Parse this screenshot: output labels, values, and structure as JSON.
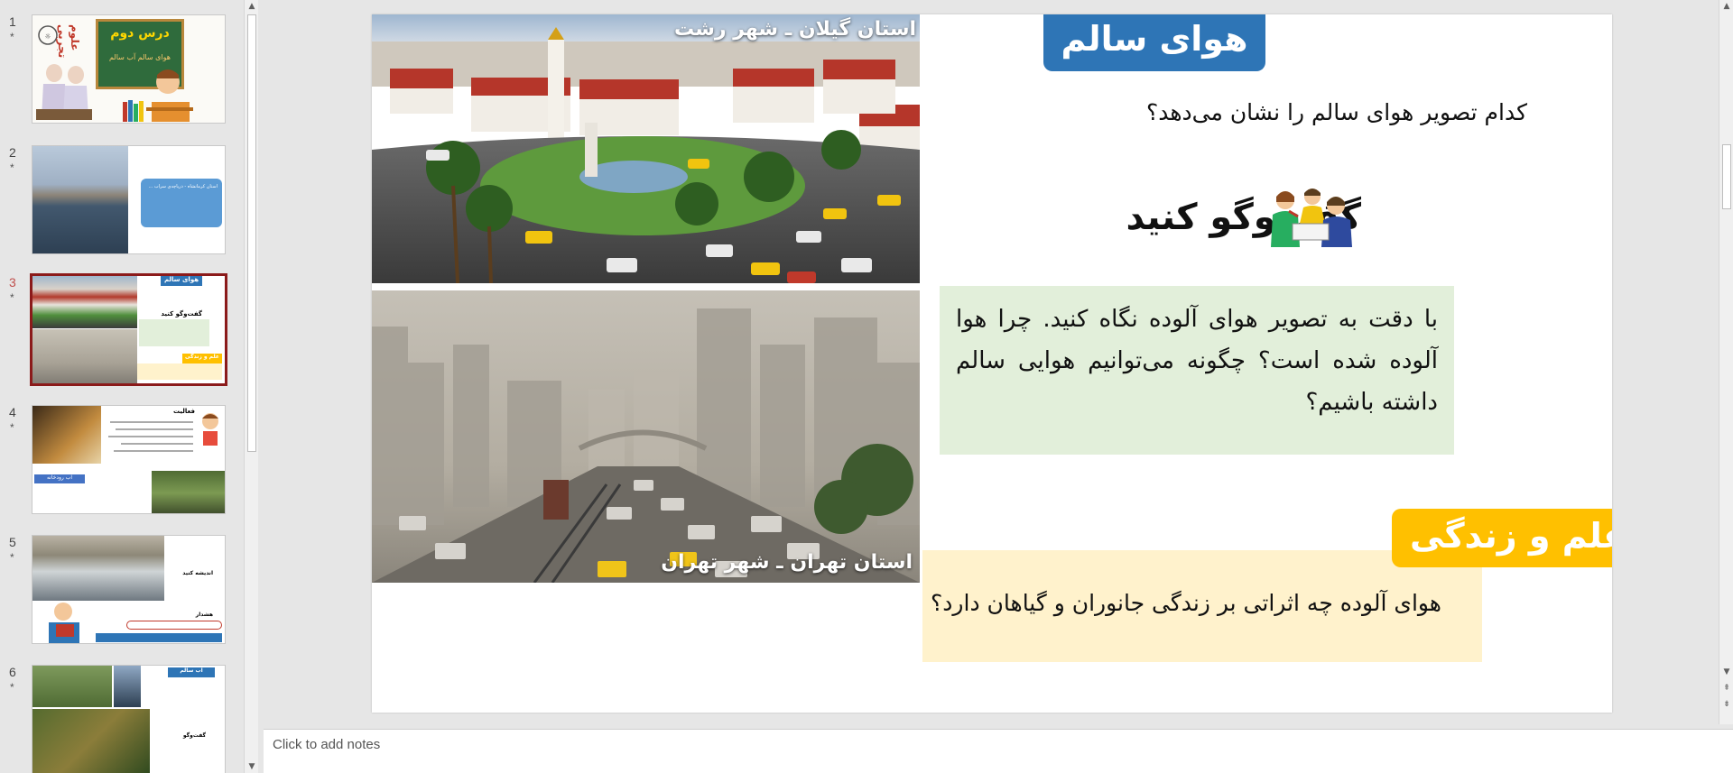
{
  "thumbnails": [
    {
      "num": "1",
      "star": "*"
    },
    {
      "num": "2",
      "star": "*"
    },
    {
      "num": "3",
      "star": "*",
      "selected": true
    },
    {
      "num": "4",
      "star": "*"
    },
    {
      "num": "5",
      "star": "*"
    },
    {
      "num": "6",
      "star": "*"
    }
  ],
  "thumb1": {
    "badge": "علوم تجربی",
    "board_title": "درس دوم",
    "board_sub": "هوای سالم آب سالم"
  },
  "thumb2": {
    "text": "استان کرمانشاه - دریاچه‌ی سراب ..."
  },
  "thumb3": {
    "title": "هوای سالم",
    "discuss": "گفت‌وگو کنید",
    "science": "علم و زندگی"
  },
  "thumb4": {
    "activity": "فعالیت",
    "tag": "آب رودخانه"
  },
  "thumb5": {
    "think": "اندیشه کنید",
    "warning": "هشدار"
  },
  "thumb6": {
    "title": "آب سالم",
    "discuss": "گفت‌وگو"
  },
  "slide": {
    "title": "هوای سالم",
    "question": "کدام تصویر هوای سالم را نشان می‌دهد؟",
    "photo_top_label": "استان گیلان ـ شهر رشت",
    "photo_bottom_label": "استان تهران ـ شهر تهران",
    "discuss_title": "گفت‌وگو کنید",
    "discuss_text": "با دقت به تصویر هوای آلوده نگاه کنید. چرا هوا آلوده شده است؟ چگونه می‌توانیم هوایی سالم داشته باشیم؟",
    "science_title": "علم و زندگی",
    "science_text": "هوای آلوده چه اثراتی بر زندگی جانوران و گیاهان دارد؟"
  },
  "notes": {
    "placeholder": "Click to add notes"
  },
  "colors": {
    "title_blue": "#2e75b6",
    "green_box": "#e2efda",
    "yellow_box": "#fff2cc",
    "yellow_tab": "#ffc000",
    "selected_border": "#8b1a1a"
  }
}
